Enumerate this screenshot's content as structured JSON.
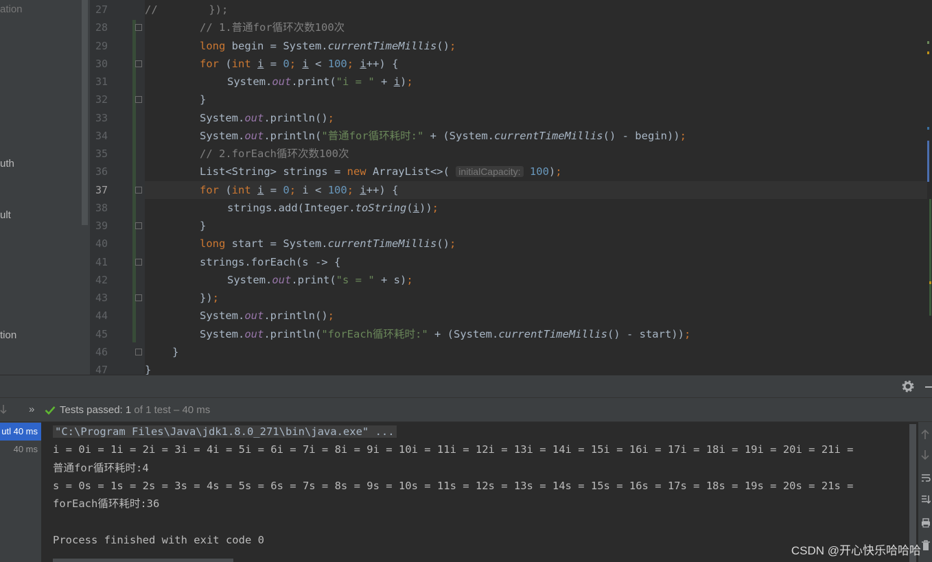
{
  "project_panel": {
    "items": [
      {
        "text": "ation"
      },
      {
        "text": "uth"
      },
      {
        "text": "ult"
      },
      {
        "text": "tion"
      }
    ]
  },
  "editor": {
    "current_line": "37",
    "line_numbers": [
      "27",
      "28",
      "29",
      "30",
      "31",
      "32",
      "33",
      "34",
      "35",
      "36",
      "37",
      "38",
      "39",
      "40",
      "41",
      "42",
      "43",
      "44",
      "45",
      "46",
      "47"
    ],
    "inlay_hint": "initialCapacity:"
  },
  "test_bar": {
    "more_icon": "»",
    "status_label": "Tests passed:",
    "passed_count": "1",
    "detail": "of 1 test – 40 ms"
  },
  "test_tree": {
    "rows": [
      {
        "label": "utl 40 ms"
      },
      {
        "label": "40 ms"
      }
    ]
  },
  "console": {
    "command": "\"C:\\Program Files\\Java\\jdk1.8.0_271\\bin\\java.exe\" ...",
    "lines": [
      "i = 0i = 1i = 2i = 3i = 4i = 5i = 6i = 7i = 8i = 9i = 10i = 11i = 12i = 13i = 14i = 15i = 16i = 17i = 18i = 19i = 20i = 21i =",
      "普通for循环耗时:4",
      "s = 0s = 1s = 2s = 3s = 4s = 5s = 6s = 7s = 8s = 9s = 10s = 11s = 12s = 13s = 14s = 15s = 16s = 17s = 18s = 19s = 20s = 21s =",
      "forEach循环耗时:36",
      "",
      "Process finished with exit code 0"
    ]
  },
  "watermark": "CSDN @开心快乐哈哈哈",
  "colors": {
    "keyword": "#cc7832",
    "number": "#6897bb",
    "string": "#6a8759",
    "comment": "#808080",
    "field": "#9876aa",
    "pass_check": "#5fb832",
    "selection": "#2f65ca"
  },
  "icons": [
    "gear-icon",
    "minimize-icon",
    "check-icon",
    "down-arrow-icon",
    "more-icon",
    "scroll-up-icon",
    "scroll-down-icon",
    "soft-wrap-icon",
    "scroll-to-end-icon",
    "print-icon",
    "trash-icon"
  ]
}
